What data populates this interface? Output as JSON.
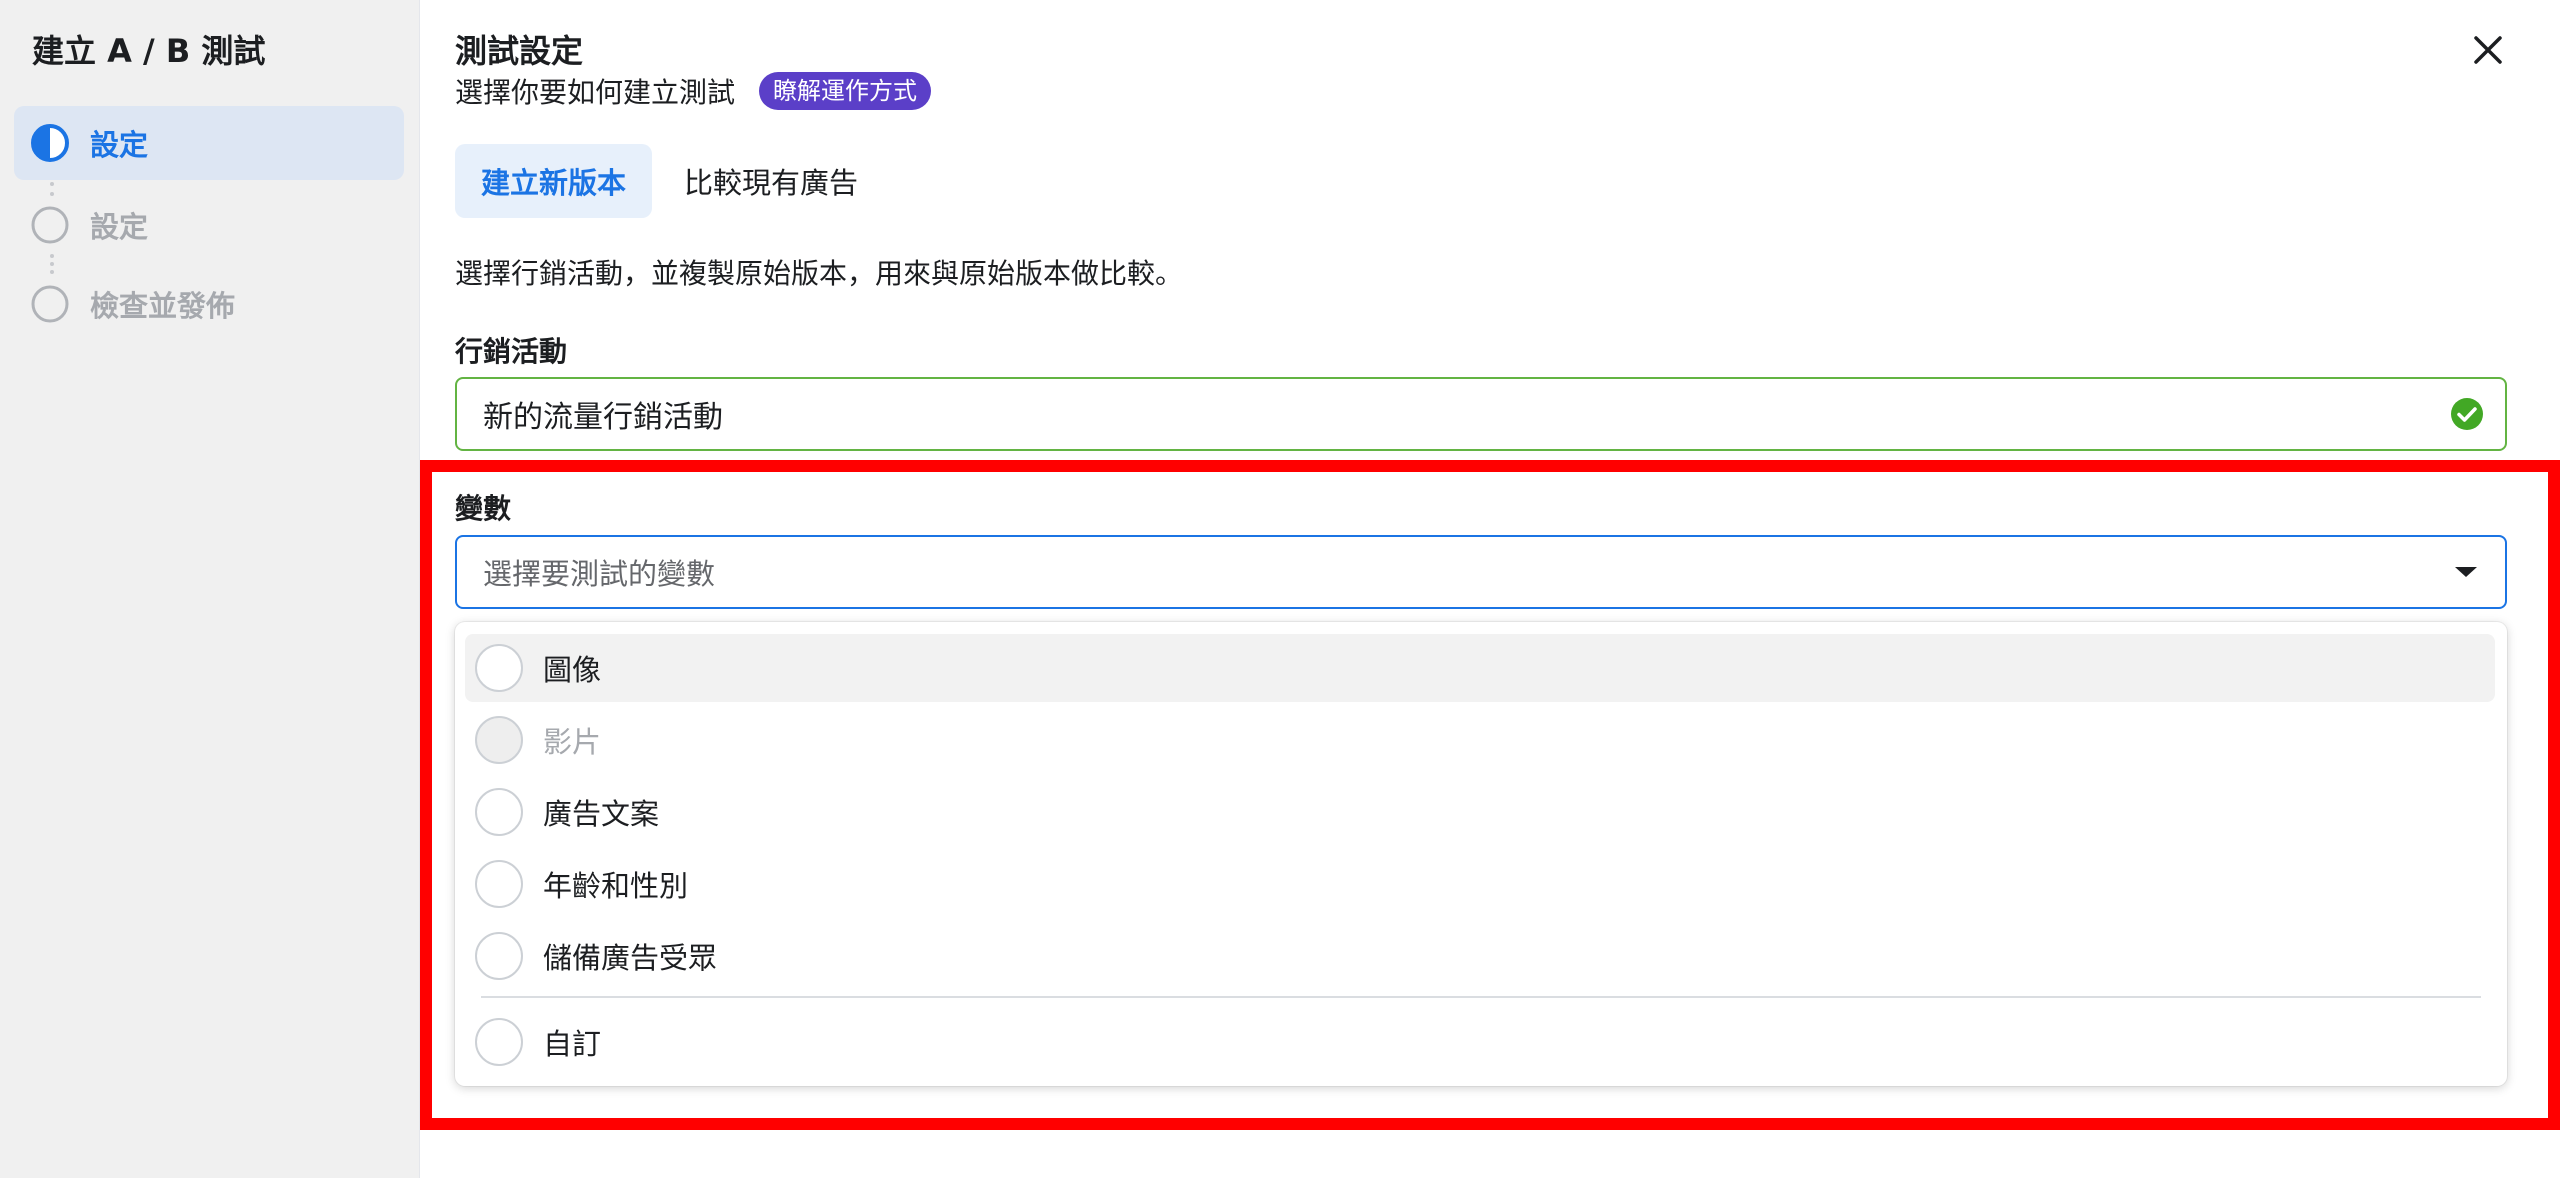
{
  "sidebar": {
    "title": "建立 A / B 測試",
    "steps": [
      {
        "label": "設定",
        "state": "active"
      },
      {
        "label": "設定",
        "state": "inactive"
      },
      {
        "label": "檢查並發佈",
        "state": "inactive"
      }
    ]
  },
  "header": {
    "title": "測試設定",
    "subtitle": "選擇你要如何建立測試",
    "learn_badge": "瞭解運作方式"
  },
  "tabs": [
    {
      "label": "建立新版本",
      "active": true
    },
    {
      "label": "比較現有廣告",
      "active": false
    }
  ],
  "description": "選擇行銷活動，並複製原始版本，用來與原始版本做比較。",
  "campaign": {
    "label": "行銷活動",
    "value": "新的流量行銷活動"
  },
  "variable": {
    "label": "變數",
    "placeholder": "選擇要測試的變數",
    "options": [
      {
        "label": "圖像",
        "disabled": false
      },
      {
        "label": "影片",
        "disabled": true
      },
      {
        "label": "廣告文案",
        "disabled": false
      },
      {
        "label": "年齡和性別",
        "disabled": false
      },
      {
        "label": "儲備廣告受眾",
        "disabled": false
      },
      {
        "label": "自訂",
        "disabled": false
      }
    ]
  },
  "colors": {
    "accent": "#1b74e4",
    "success": "#63b443",
    "badge": "#5b3fc8",
    "highlight": "#ff0000"
  },
  "icons": {
    "close": "close-icon",
    "check": "check-circle-icon",
    "caret": "caret-down-icon",
    "step_active": "half-circle-icon",
    "step_inactive": "circle-icon"
  }
}
